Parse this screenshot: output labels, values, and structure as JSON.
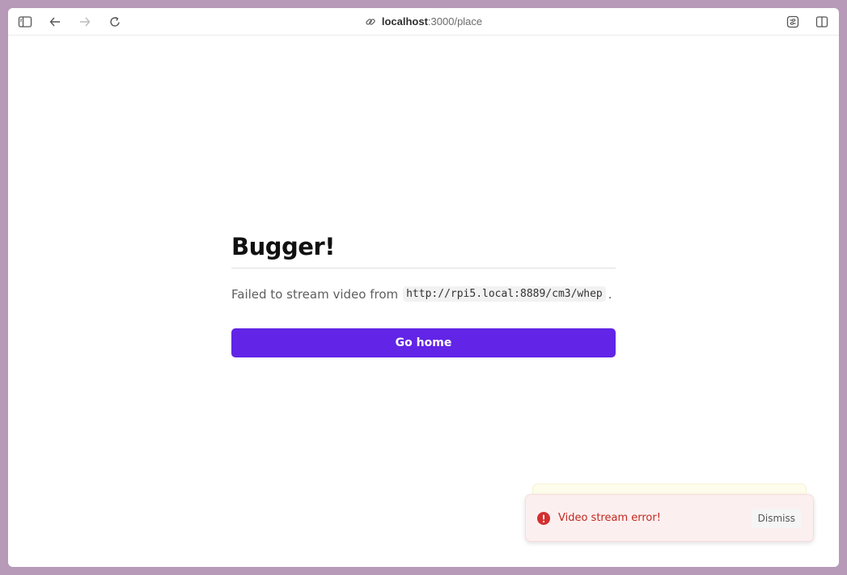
{
  "browser": {
    "url_host": "localhost",
    "url_path": ":3000/place",
    "icons": [
      "sidebar-icon",
      "back-arrow-icon",
      "forward-arrow-icon",
      "reload-icon",
      "link-icon",
      "extensions-icon",
      "split-view-icon"
    ]
  },
  "page": {
    "heading": "Bugger!",
    "message_prefix": "Failed to stream video from",
    "stream_url": "http://rpi5.local:8889/cm3/whep",
    "message_suffix": ".",
    "button_label": "Go home"
  },
  "toast": {
    "message": "Video stream error!",
    "dismiss_label": "Dismiss",
    "icon": "alert-circle-icon"
  },
  "colors": {
    "accent": "#6224e6",
    "error": "#c0281f",
    "toast_bg": "#fcefef",
    "frame": "#b79ab7"
  }
}
